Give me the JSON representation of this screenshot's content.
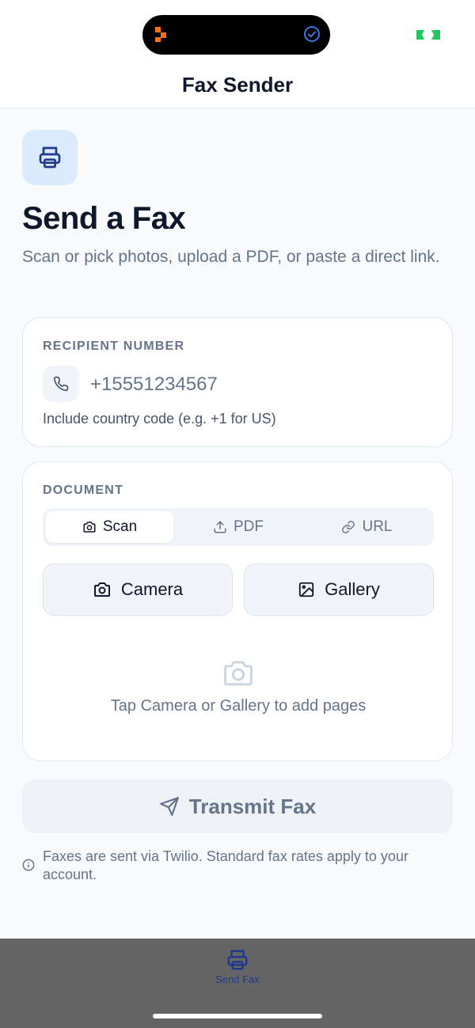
{
  "header": {
    "title": "Fax Sender"
  },
  "hero": {
    "title": "Send a Fax",
    "subtitle": "Scan or pick photos, upload a PDF, or paste a direct link."
  },
  "recipient": {
    "label": "RECIPIENT NUMBER",
    "placeholder": "+15551234567",
    "helper": "Include country code (e.g. +1 for US)"
  },
  "document": {
    "label": "DOCUMENT",
    "tabs": [
      {
        "label": "Scan",
        "icon": "camera-icon",
        "active": true
      },
      {
        "label": "PDF",
        "icon": "upload-icon",
        "active": false
      },
      {
        "label": "URL",
        "icon": "link-icon",
        "active": false
      }
    ],
    "buttons": {
      "camera": "Camera",
      "gallery": "Gallery"
    },
    "empty_text": "Tap Camera or Gallery to add pages"
  },
  "transmit": {
    "label": "Transmit Fax"
  },
  "note": "Faxes are sent via Twilio. Standard fax rates apply to your account.",
  "bottom_nav": {
    "items": [
      {
        "label": "Send Fax",
        "icon": "printer-icon",
        "active": true
      }
    ]
  },
  "colors": {
    "accent": "#1e3a8a",
    "accent_light": "#dbeafe",
    "muted": "#64748b",
    "battery": "#22c55e"
  }
}
